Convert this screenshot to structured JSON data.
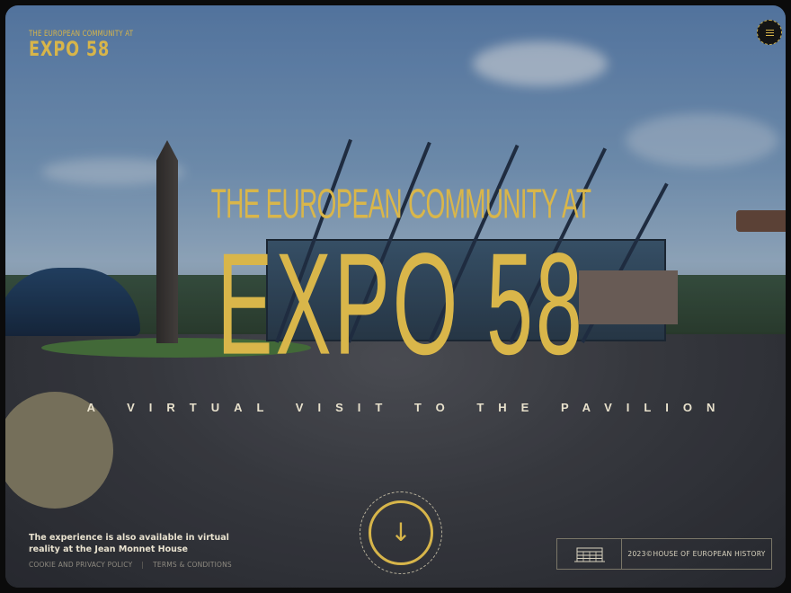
{
  "header": {
    "logo_small": "THE EUROPEAN COMMUNITY AT",
    "logo_big": "EXPO 58",
    "menu_icon": "hamburger-menu-icon"
  },
  "hero": {
    "title_line1": "THE EUROPEAN COMMUNITY AT",
    "title_line2": "EXPO 58",
    "subtitle": "A VIRTUAL VISIT TO THE PAVILION",
    "scroll_icon": "arrow-down-icon",
    "scroll_glyph": "↓",
    "background": "expo-58-pavilion-3d-render"
  },
  "footer": {
    "vr_notice": "The experience is also available in virtual reality at the Jean Monnet House",
    "links": [
      "COOKIE AND PRIVACY POLICY",
      "TERMS & CONDITIONS"
    ],
    "credit_icon": "house-of-european-history-building-icon",
    "credit_text": "2023©HOUSE OF EUROPEAN HISTORY"
  },
  "colors": {
    "accent": "#d9b64a",
    "text_light": "#e9e2cf",
    "frame": "#0b0b0b"
  }
}
